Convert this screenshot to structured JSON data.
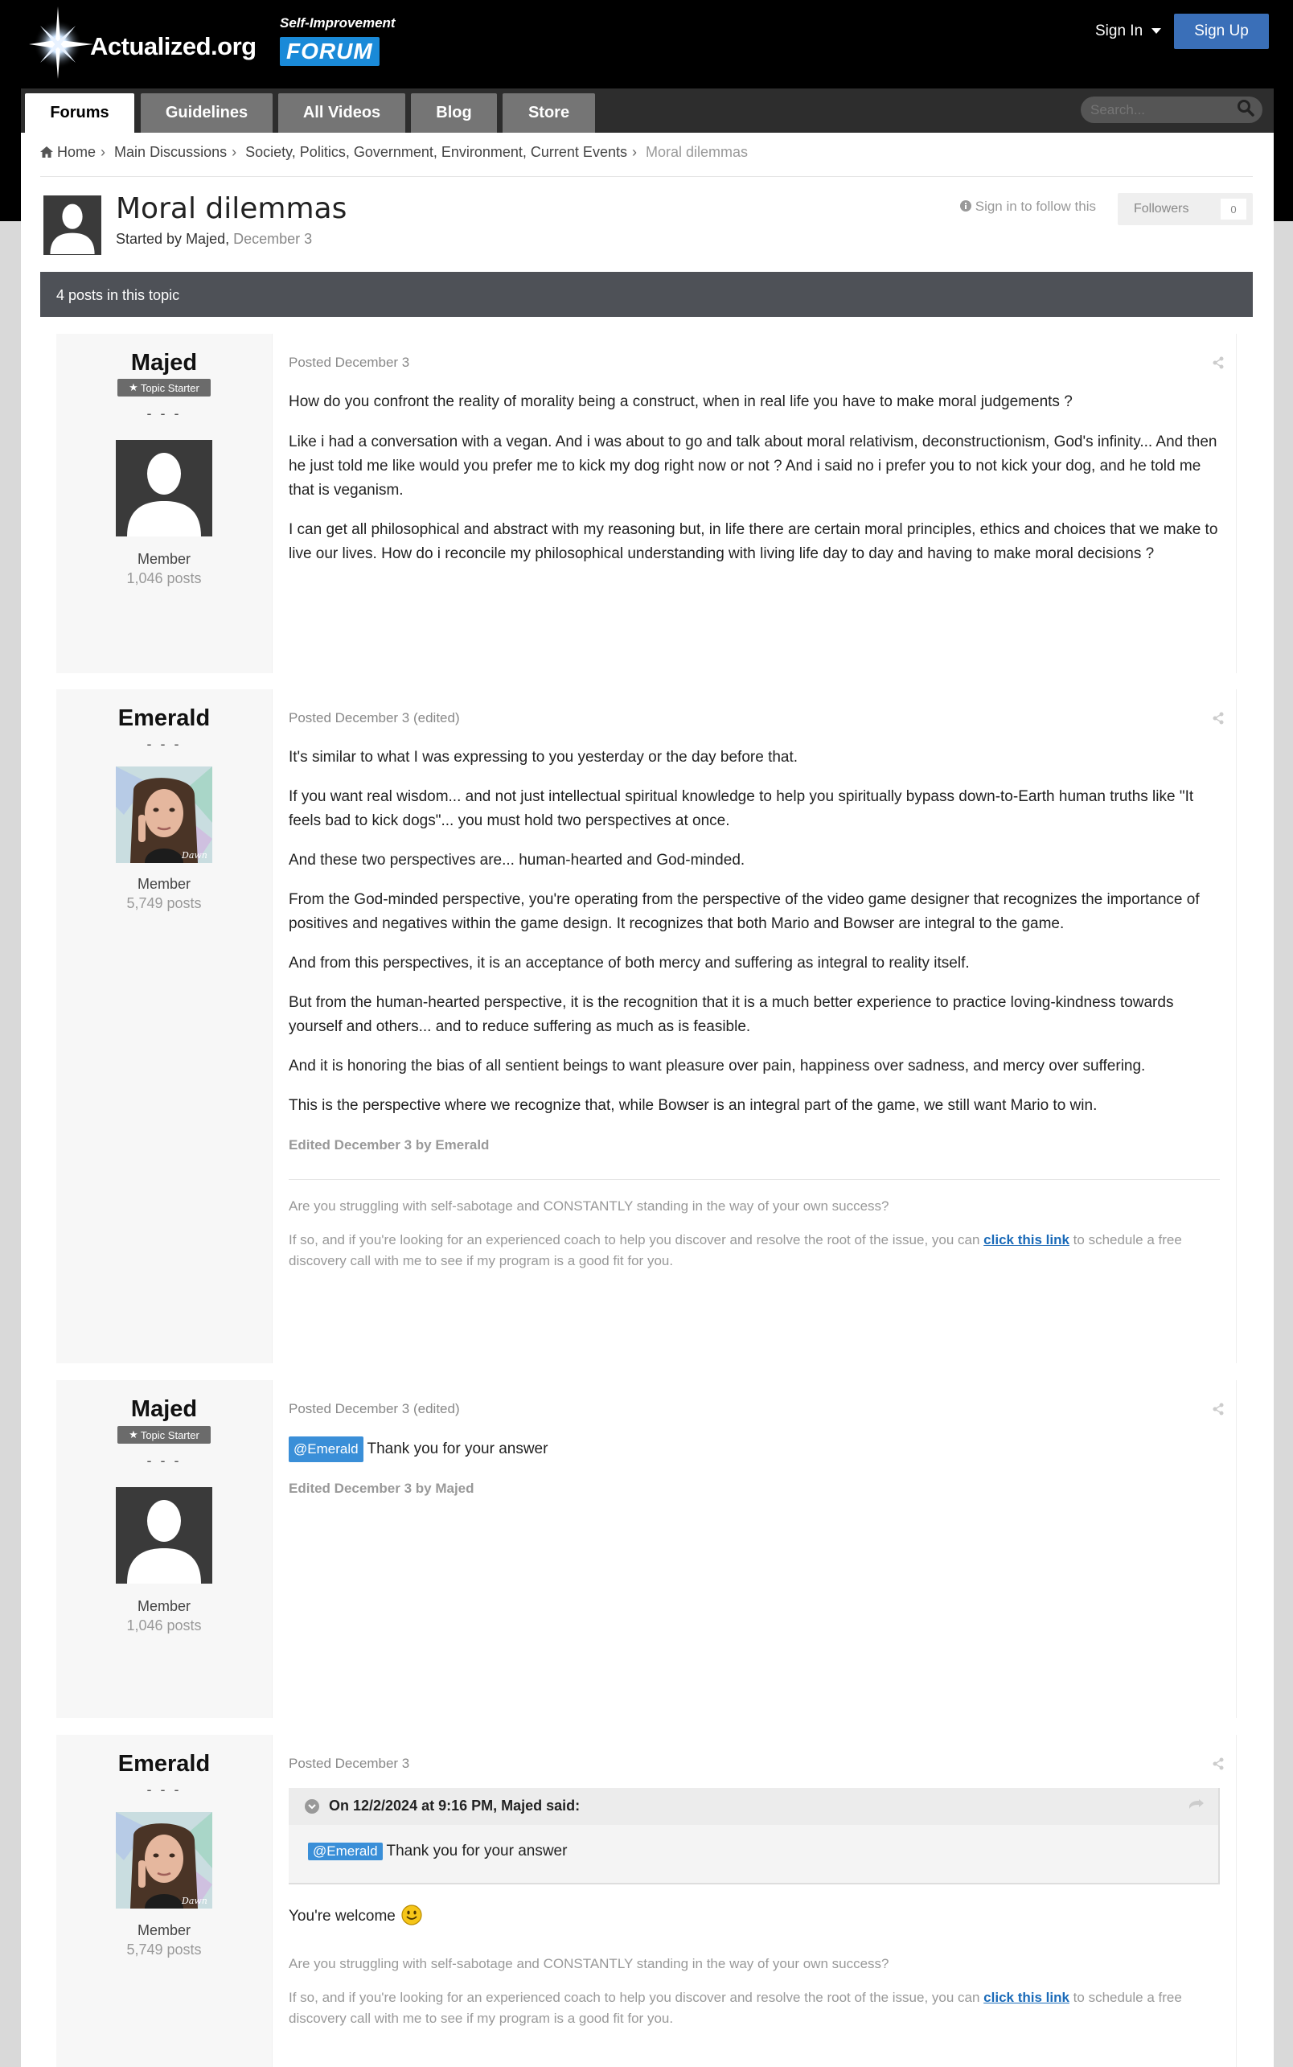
{
  "header": {
    "logo_text": "Actualized.org",
    "logo_sub": "Self-Improvement",
    "logo_forum": "FORUM",
    "sign_in": "Sign In",
    "sign_up": "Sign Up"
  },
  "nav": {
    "tabs": [
      "Forums",
      "Guidelines",
      "All Videos",
      "Blog",
      "Store"
    ],
    "search_placeholder": "Search..."
  },
  "breadcrumbs": [
    "Home",
    "Main Discussions",
    "Society, Politics, Government, Environment, Current Events",
    "Moral dilemmas"
  ],
  "topic": {
    "title": "Moral dilemmas",
    "started_by_prefix": "Started by",
    "started_by": "Majed",
    "date": "December 3",
    "follow_text": "Sign in to follow this",
    "followers_label": "Followers",
    "followers_count": "0",
    "posts_count_text": "4 posts in this topic"
  },
  "posts": [
    {
      "author": "Majed",
      "badge": "Topic Starter",
      "dashes": "- - -",
      "rank": "Member",
      "post_count": "1,046 posts",
      "posted": "Posted December 3",
      "paragraphs": [
        "How do you confront the reality of morality being a construct, when in real life you have to make moral judgements ?",
        "Like i had a conversation with a vegan. And i was about to go and talk about moral relativism, deconstructionism, God's infinity... And then he just told me like would you prefer me to kick my dog right now or not ? And i said no i prefer you to not kick your dog, and he told me that is veganism.",
        "I can get all philosophical and abstract with my reasoning but, in life there are certain moral principles, ethics and choices that we make to live our lives. How do i reconcile my philosophical understanding with living life day to day and having to make moral decisions ?"
      ]
    },
    {
      "author": "Emerald",
      "dashes": "- - -",
      "rank": "Member",
      "post_count": "5,749 posts",
      "posted": "Posted December 3 (edited)",
      "paragraphs": [
        "It's similar to what I was expressing to you yesterday or the day before that.",
        "If you want real wisdom... and not just intellectual spiritual knowledge to help you spiritually bypass down-to-Earth human truths like \"It feels bad to kick dogs\"... you must hold two perspectives at once.",
        "And these two perspectives are... human-hearted and God-minded.",
        "From the God-minded perspective, you're operating from the perspective of the video game designer that recognizes the importance of positives and negatives within the game design. It recognizes that both Mario and Bowser are integral to the game.",
        "And from this perspectives, it is an acceptance of both mercy and suffering as integral to reality itself.",
        "But from the human-hearted perspective, it is the recognition that it is a much better experience to practice loving-kindness towards yourself and others... and to reduce suffering as much as is feasible.",
        "And it is honoring the bias of all sentient beings to want pleasure over pain, happiness over sadness, and mercy over suffering.",
        "This is the perspective where we recognize that, while Bowser is an integral part of the game, we still want Mario to win."
      ],
      "edited": "Edited December 3 by Emerald",
      "sig_q": "Are you struggling with self-sabotage and CONSTANTLY standing in the way of your own success?",
      "sig_a1": "If so, and if you're looking for an experienced coach to help you discover and resolve the root of the issue, you can",
      "sig_link": "click this link",
      "sig_a2": "to schedule a free discovery call with me to see if my program is a good fit for you."
    },
    {
      "author": "Majed",
      "badge": "Topic Starter",
      "dashes": "- - -",
      "rank": "Member",
      "post_count": "1,046 posts",
      "posted": "Posted December 3 (edited)",
      "mention": "@Emerald",
      "text": "Thank you for your answer",
      "edited": "Edited December 3 by Majed"
    },
    {
      "author": "Emerald",
      "dashes": "- - -",
      "rank": "Member",
      "post_count": "5,749 posts",
      "posted": "Posted December 3",
      "quote_head": "On 12/2/2024 at 9:16 PM, Majed said:",
      "quote_mention": "@Emerald",
      "quote_text": "Thank you for your answer",
      "reply": "You're welcome",
      "sig_q": "Are you struggling with self-sabotage and CONSTANTLY standing in the way of your own success?",
      "sig_a1": "If so, and if you're looking for an experienced coach to help you discover and resolve the root of the issue, you can",
      "sig_link": "click this link",
      "sig_a2": "to schedule a free discovery call with me to see if my program is a good fit for you."
    }
  ],
  "colors": {
    "header_bg": "#000000",
    "signup_bg": "#3a6fb8",
    "topic_bar": "#4e5157",
    "mention_bg": "#3a8fd8",
    "link": "#1a6ab8"
  }
}
